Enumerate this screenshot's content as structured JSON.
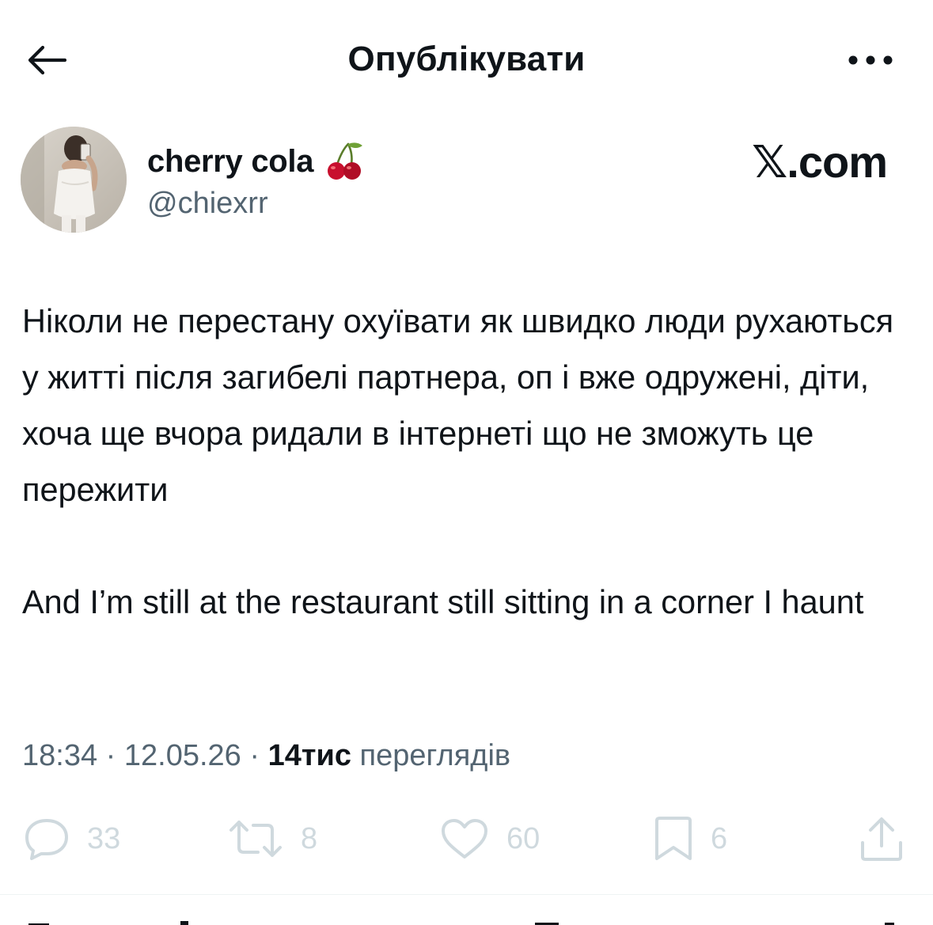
{
  "header": {
    "title": "Опублікувати",
    "back_icon": "arrow-left-icon",
    "more_icon": "more-horizontal-icon"
  },
  "author": {
    "display_name": "cherry cola",
    "name_emoji_icon": "cherry-icon",
    "handle": "@chiexrr",
    "brand": "𝕏.com"
  },
  "tweet": {
    "paragraph_1": "Ніколи не перестану охуївати як швидко люди рухаються у житті після загибелі партнера, оп і вже одружені, діти, хоча ще вчора ридали в інтернеті що не зможуть це пережити",
    "paragraph_2": "And I’m still at the restaurant still sitting in a corner I haunt"
  },
  "meta": {
    "time": "18:34",
    "separator_1": " · ",
    "date": "12.05.26",
    "separator_2": " · ",
    "views_count": "14тис",
    "views_label": " переглядів"
  },
  "actions": {
    "reply": {
      "icon": "reply-icon",
      "count": "33"
    },
    "repost": {
      "icon": "repost-icon",
      "count": "8"
    },
    "like": {
      "icon": "heart-icon",
      "count": "60"
    },
    "bookmark": {
      "icon": "bookmark-icon",
      "count": "6"
    },
    "share": {
      "icon": "share-icon"
    }
  },
  "colors": {
    "text_primary": "#0f1419",
    "text_secondary": "#536471",
    "action_faded": "#cfd9de",
    "divider": "#eff3f4",
    "background": "#ffffff"
  }
}
